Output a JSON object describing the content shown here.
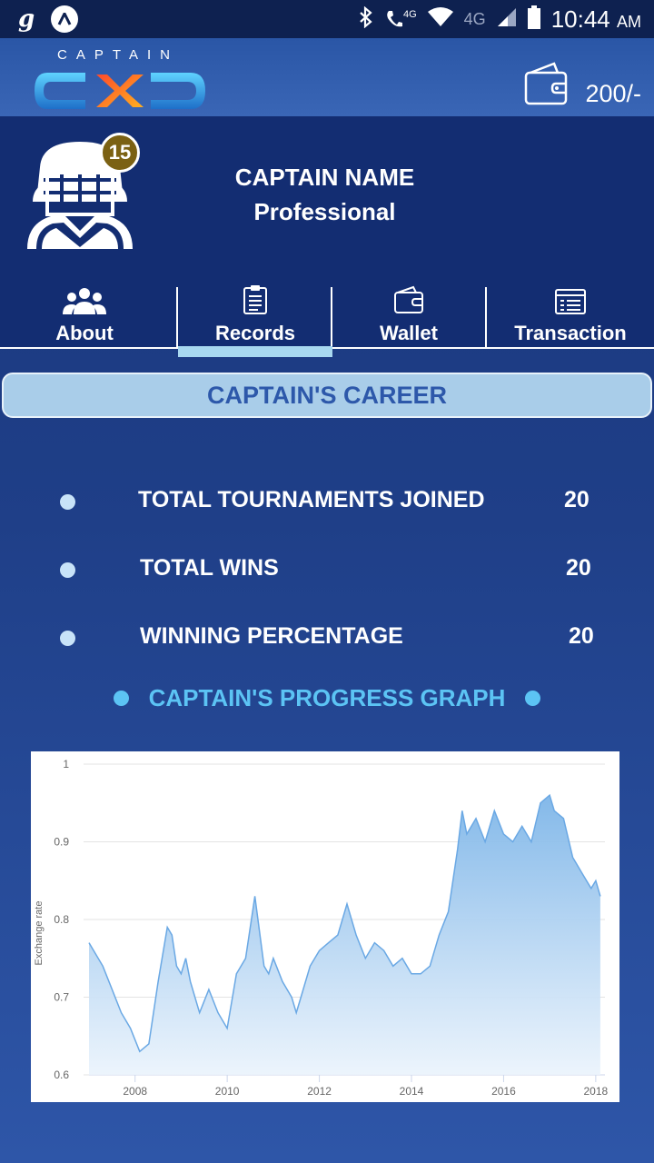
{
  "status_bar": {
    "time": "10:44",
    "ampm": "AM",
    "network_a": "4G",
    "network_b": "4G"
  },
  "header": {
    "logo_text": "CAPTAIN",
    "wallet_amount": "200/-"
  },
  "profile": {
    "badge_count": "15",
    "name": "CAPTAIN NAME",
    "level": "Professional"
  },
  "tabs": [
    {
      "label": "About",
      "icon": "users-icon"
    },
    {
      "label": "Records",
      "icon": "clipboard-icon"
    },
    {
      "label": "Wallet",
      "icon": "wallet-icon"
    },
    {
      "label": "Transaction",
      "icon": "receipt-icon"
    }
  ],
  "career": {
    "title": "CAPTAIN'S CAREER",
    "stats": [
      {
        "label": "TOTAL TOURNAMENTS JOINED",
        "value": "20"
      },
      {
        "label": "TOTAL WINS",
        "value": "20"
      },
      {
        "label": "WINNING PERCENTAGE",
        "value": "20"
      }
    ],
    "graph_title": "CAPTAIN'S PROGRESS GRAPH"
  },
  "colors": {
    "status_bar": "#0e2150",
    "header": "#3a66b6",
    "profile_bg": "#132d72",
    "accent_light": "#a9cde9",
    "graph_title": "#5cc4f4",
    "series_fill": "#7db5e8"
  },
  "chart_data": {
    "type": "area",
    "ylabel": "Exchange rate",
    "xlabel": "",
    "ylim": [
      0.6,
      1.0
    ],
    "xlim": [
      2007.0,
      2018.2
    ],
    "y_ticks": [
      "0.6",
      "0.7",
      "0.8",
      "0.9",
      "1"
    ],
    "x_ticks": [
      "2008",
      "2010",
      "2012",
      "2014",
      "2016",
      "2018"
    ],
    "grid": true,
    "x": [
      2007.0,
      2007.1,
      2007.3,
      2007.5,
      2007.7,
      2007.9,
      2008.1,
      2008.3,
      2008.5,
      2008.7,
      2008.8,
      2008.9,
      2009.0,
      2009.1,
      2009.2,
      2009.4,
      2009.6,
      2009.8,
      2010.0,
      2010.2,
      2010.4,
      2010.6,
      2010.8,
      2010.9,
      2011.0,
      2011.2,
      2011.4,
      2011.5,
      2011.6,
      2011.8,
      2012.0,
      2012.2,
      2012.4,
      2012.6,
      2012.8,
      2013.0,
      2013.2,
      2013.4,
      2013.6,
      2013.8,
      2014.0,
      2014.2,
      2014.4,
      2014.6,
      2014.8,
      2015.0,
      2015.1,
      2015.2,
      2015.4,
      2015.6,
      2015.8,
      2016.0,
      2016.2,
      2016.4,
      2016.6,
      2016.8,
      2017.0,
      2017.1,
      2017.3,
      2017.5,
      2017.7,
      2017.9,
      2018.0,
      2018.1
    ],
    "values": [
      0.77,
      0.76,
      0.74,
      0.71,
      0.68,
      0.66,
      0.63,
      0.64,
      0.72,
      0.79,
      0.78,
      0.74,
      0.73,
      0.75,
      0.72,
      0.68,
      0.71,
      0.68,
      0.66,
      0.73,
      0.75,
      0.83,
      0.74,
      0.73,
      0.75,
      0.72,
      0.7,
      0.68,
      0.7,
      0.74,
      0.76,
      0.77,
      0.78,
      0.82,
      0.78,
      0.75,
      0.77,
      0.76,
      0.74,
      0.75,
      0.73,
      0.73,
      0.74,
      0.78,
      0.81,
      0.89,
      0.94,
      0.91,
      0.93,
      0.9,
      0.94,
      0.91,
      0.9,
      0.92,
      0.9,
      0.95,
      0.96,
      0.94,
      0.93,
      0.88,
      0.86,
      0.84,
      0.85,
      0.83
    ]
  }
}
